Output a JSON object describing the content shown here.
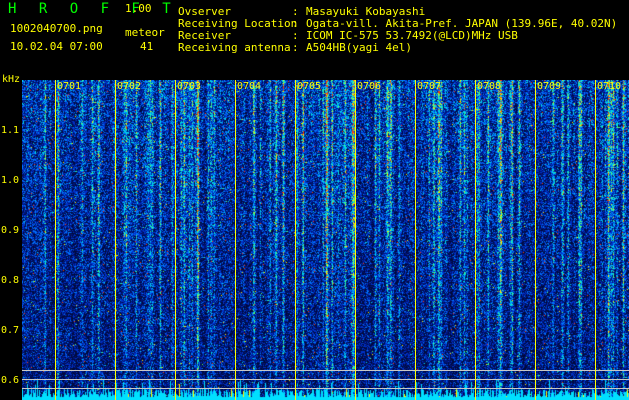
{
  "header": {
    "title": "H R O F F T",
    "version": "1.00",
    "filename": "1002040700.png",
    "datetime": "10.02.04 07:00",
    "meteor_label": "meteor",
    "meteor_count": "41"
  },
  "info": [
    {
      "key": "Ovserver",
      "sep": ":",
      "value": "Masayuki Kobayashi"
    },
    {
      "key": "Receiving Location",
      "sep": ":",
      "value": "Ogata-vill. Akita-Pref. JAPAN (139.96E, 40.02N)"
    },
    {
      "key": "Receiver",
      "sep": ":",
      "value": "ICOM IC-575 53.7492(@LCD)MHz USB"
    },
    {
      "key": "Receiving antenna",
      "sep": ":",
      "value": "A504HB(yagi 4el)"
    }
  ],
  "spectrogram": {
    "y_unit": "kHz",
    "y_ticks": [
      "1.1",
      "1.0",
      "0.9",
      "0.8",
      "0.7",
      "0.6"
    ],
    "x_ticks": [
      "0701",
      "0702",
      "0703",
      "0704",
      "0705",
      "0706",
      "0707",
      "0708",
      "0709",
      "0710"
    ]
  },
  "colors": {
    "text_green": "#00ff00",
    "text_yellow": "#ffff00",
    "background": "#000000",
    "spectrum_low": "#001060",
    "spectrum_high": "#ff2000"
  }
}
